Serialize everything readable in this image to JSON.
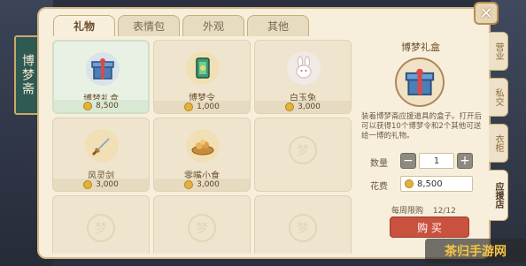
{
  "sign_text": "博梦斋",
  "close_label": "✕",
  "tabs": [
    "礼物",
    "表情包",
    "外观",
    "其他"
  ],
  "items": [
    {
      "name": "博梦礼盒",
      "price": "8,500",
      "icon": "gift-box-icon"
    },
    {
      "name": "博梦令",
      "price": "1,000",
      "icon": "token-icon"
    },
    {
      "name": "白玉兔",
      "price": "3,000",
      "icon": "rabbit-icon"
    },
    {
      "name": "风灵剑",
      "price": "3,000",
      "icon": "sword-icon"
    },
    {
      "name": "零嘴小食",
      "price": "3,000",
      "icon": "snack-icon"
    }
  ],
  "placeholder_seal": "梦",
  "detail": {
    "title": "博梦礼盒",
    "description": "装着博梦斋应援道具的盒子。打开后可以获得10个博梦令和2个其他可送给一博的礼物。",
    "qty_label": "数量",
    "qty_value": "1",
    "cost_label": "花费",
    "cost_value": "8,500",
    "limit_label": "每周限购",
    "limit_value": "12/12",
    "buy_label": "购 买"
  },
  "side_tabs": [
    "营业",
    "私交",
    "衣柜",
    "应援店"
  ],
  "watermark": "茶归手游网",
  "colors": {
    "panel_bg": "#f7efdc",
    "buy_button": "#c9523f",
    "selected_card": "#e9f1e4",
    "coin": "#e3b23c"
  }
}
